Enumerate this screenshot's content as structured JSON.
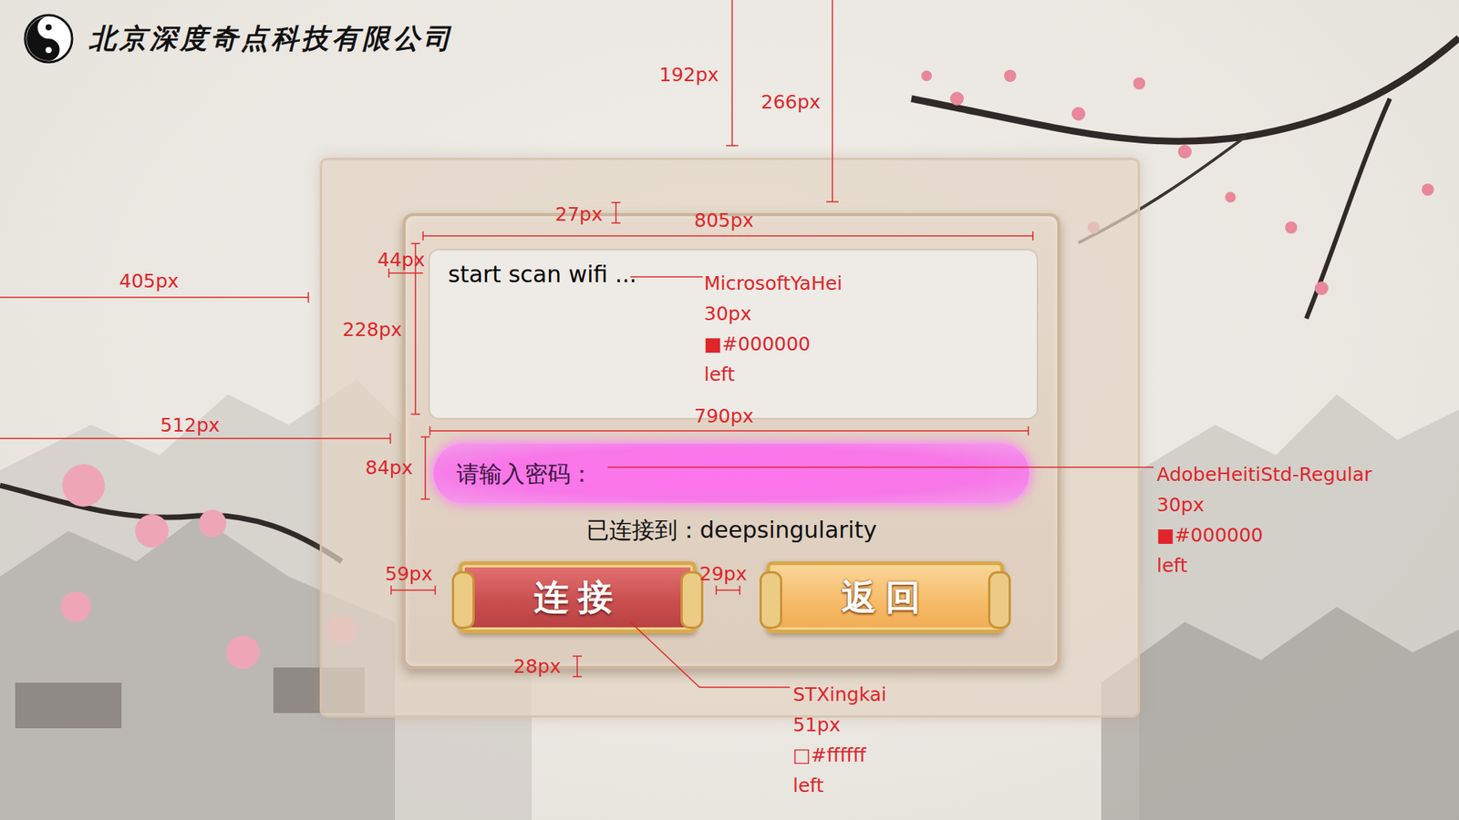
{
  "company": {
    "name": "北京深度奇点科技有限公司"
  },
  "log": {
    "text": "start scan wifi ..."
  },
  "password": {
    "placeholder": "请输入密码："
  },
  "status": {
    "text": "已连接到：deepsingularity"
  },
  "buttons": [
    {
      "label": "连接",
      "kind": "primary"
    },
    {
      "label": "返回",
      "kind": "secondary"
    }
  ],
  "dimensions": [
    {
      "text": "192px"
    },
    {
      "text": "266px"
    },
    {
      "text": "27px"
    },
    {
      "text": "805px"
    },
    {
      "text": "405px"
    },
    {
      "text": "44px"
    },
    {
      "text": "228px"
    },
    {
      "text": "512px"
    },
    {
      "text": "790px"
    },
    {
      "text": "84px"
    },
    {
      "text": "59px"
    },
    {
      "text": "29px"
    },
    {
      "text": "28px"
    }
  ],
  "specs": [
    {
      "lines": [
        "MicrosoftYaHei",
        "30px",
        "■#000000",
        "left"
      ]
    },
    {
      "lines": [
        "AdobeHeitiStd-Regular",
        "30px",
        "■#000000",
        "left"
      ]
    },
    {
      "lines": [
        "STXingkai",
        "51px",
        "□#ffffff",
        "left"
      ]
    }
  ]
}
